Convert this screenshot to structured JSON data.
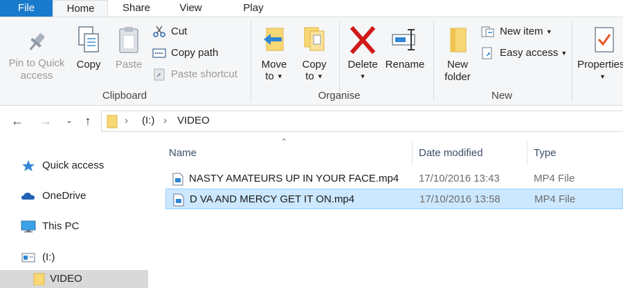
{
  "tabs": [
    {
      "label": "File"
    },
    {
      "label": "Home"
    },
    {
      "label": "Share"
    },
    {
      "label": "View"
    },
    {
      "label": "Play"
    }
  ],
  "ribbon": {
    "clipboard": {
      "pin_label": "Pin to Quick access",
      "copy_label": "Copy",
      "paste_label": "Paste",
      "cut_label": "Cut",
      "copy_path_label": "Copy path",
      "paste_shortcut_label": "Paste shortcut",
      "group_label": "Clipboard"
    },
    "organise": {
      "move_to_label": "Move to",
      "copy_to_label": "Copy to",
      "delete_label": "Delete",
      "rename_label": "Rename",
      "group_label": "Organise"
    },
    "new": {
      "new_folder_label": "New folder",
      "new_item_label": "New item",
      "easy_access_label": "Easy access",
      "group_label": "New"
    },
    "open": {
      "properties_label": "Properties"
    }
  },
  "address": {
    "drive": "(I:)",
    "folder": "VIDEO"
  },
  "nav_pane": {
    "items": [
      {
        "label": "Quick access",
        "icon": "star-icon"
      },
      {
        "label": "OneDrive",
        "icon": "cloud-icon"
      },
      {
        "label": "This PC",
        "icon": "monitor-icon"
      },
      {
        "label": "(I:)",
        "icon": "drive-icon"
      },
      {
        "label": "VIDEO",
        "icon": "folder-icon"
      }
    ]
  },
  "file_list": {
    "columns": [
      "Name",
      "Date modified",
      "Type"
    ],
    "rows": [
      {
        "name": "NASTY AMATEURS UP IN YOUR FACE.mp4",
        "date": "17/10/2016 13:43",
        "type": "MP4 File",
        "selected": false
      },
      {
        "name": "D VA AND MERCY GET IT ON.mp4",
        "date": "17/10/2016 13:58",
        "type": "MP4 File",
        "selected": true
      }
    ]
  },
  "colors": {
    "file_tab": "#1979ca",
    "selection": "#cce8ff",
    "selection_border": "#99d1ff",
    "ribbon_bg": "#f5f6f7",
    "delete_red": "#d01a1a"
  }
}
